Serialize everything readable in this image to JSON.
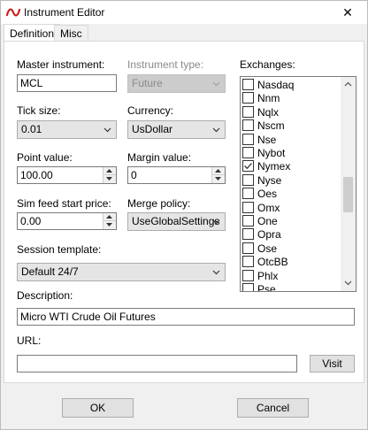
{
  "window": {
    "title": "Instrument Editor",
    "close_glyph": "✕"
  },
  "tabs": [
    {
      "label": "Definition",
      "active": true
    },
    {
      "label": "Misc",
      "active": false
    }
  ],
  "form": {
    "master_instrument": {
      "label": "Master instrument:",
      "value": "MCL"
    },
    "instrument_type": {
      "label": "Instrument type:",
      "value": "Future",
      "disabled": true
    },
    "tick_size": {
      "label": "Tick size:",
      "value": "0.01"
    },
    "currency": {
      "label": "Currency:",
      "value": "UsDollar"
    },
    "point_value": {
      "label": "Point value:",
      "value": "100.00"
    },
    "margin_value": {
      "label": "Margin value:",
      "value": "0"
    },
    "sim_feed_start_price": {
      "label": "Sim feed start price:",
      "value": "0.00"
    },
    "merge_policy": {
      "label": "Merge policy:",
      "value": "UseGlobalSettings"
    },
    "session_template": {
      "label": "Session template:",
      "value": "Default 24/7"
    },
    "description": {
      "label": "Description:",
      "value": "Micro WTI Crude Oil Futures"
    },
    "url": {
      "label": "URL:",
      "value": ""
    },
    "visit_label": "Visit"
  },
  "exchanges": {
    "label": "Exchanges:",
    "items": [
      {
        "name": "Nasdaq",
        "checked": false
      },
      {
        "name": "Nnm",
        "checked": false
      },
      {
        "name": "Nqlx",
        "checked": false
      },
      {
        "name": "Nscm",
        "checked": false
      },
      {
        "name": "Nse",
        "checked": false
      },
      {
        "name": "Nybot",
        "checked": false
      },
      {
        "name": "Nymex",
        "checked": true
      },
      {
        "name": "Nyse",
        "checked": false
      },
      {
        "name": "Oes",
        "checked": false
      },
      {
        "name": "Omx",
        "checked": false
      },
      {
        "name": "One",
        "checked": false
      },
      {
        "name": "Opra",
        "checked": false
      },
      {
        "name": "Ose",
        "checked": false
      },
      {
        "name": "OtcBB",
        "checked": false
      },
      {
        "name": "Phlx",
        "checked": false
      },
      {
        "name": "Pse",
        "checked": false
      }
    ]
  },
  "footer": {
    "ok_label": "OK",
    "cancel_label": "Cancel"
  },
  "colors": {
    "app_icon": "#c8201c"
  }
}
